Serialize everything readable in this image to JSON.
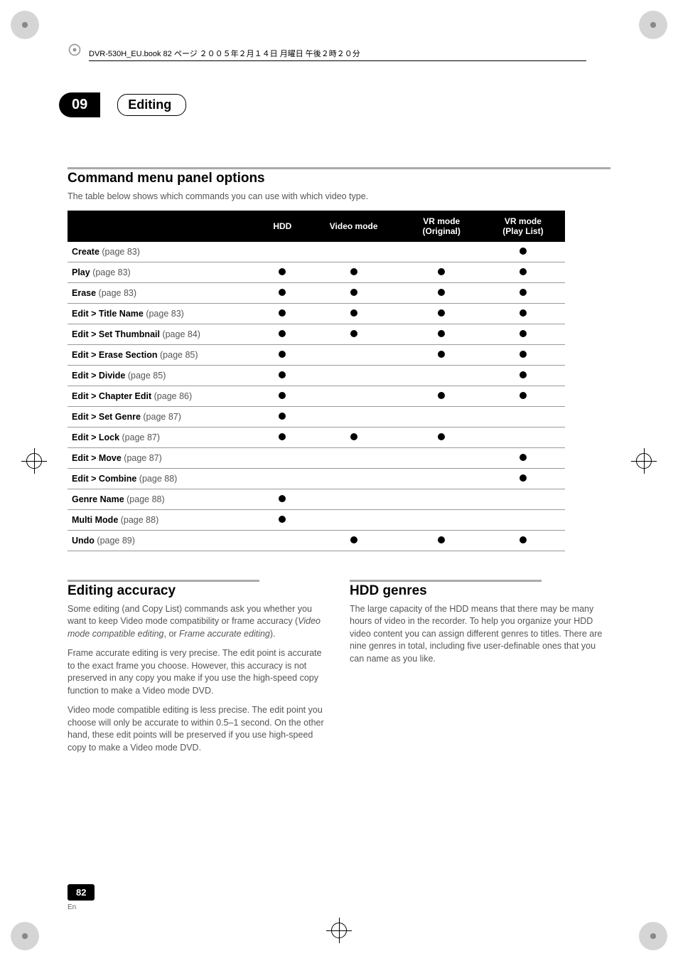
{
  "header": {
    "file_info": "DVR-530H_EU.book 82 ページ ２００５年２月１４日 月曜日 午後２時２０分"
  },
  "badge": {
    "number": "09",
    "section": "Editing"
  },
  "section1": {
    "title": "Command menu panel options",
    "intro": "The table below shows which commands you can use with which video type."
  },
  "table": {
    "headers": [
      "",
      "HDD",
      "Video mode",
      "VR mode (Original)",
      "VR mode (Play List)"
    ],
    "rows": [
      {
        "label_bold": "Create",
        "label_rest": " (page 83)",
        "cells": [
          "",
          "",
          "",
          "●"
        ]
      },
      {
        "label_bold": "Play",
        "label_rest": " (page 83)",
        "cells": [
          "●",
          "●",
          "●",
          "●"
        ]
      },
      {
        "label_bold": "Erase",
        "label_rest": " (page 83)",
        "cells": [
          "●",
          "●",
          "●",
          "●"
        ]
      },
      {
        "label_bold": "Edit > Title Name",
        "label_rest": " (page 83)",
        "cells": [
          "●",
          "●",
          "●",
          "●"
        ]
      },
      {
        "label_bold": "Edit > Set Thumbnail",
        "label_rest": " (page 84)",
        "cells": [
          "●",
          "●",
          "●",
          "●"
        ]
      },
      {
        "label_bold": "Edit > Erase Section",
        "label_rest": " (page 85)",
        "cells": [
          "●",
          "",
          "●",
          "●"
        ]
      },
      {
        "label_bold": "Edit > Divide",
        "label_rest": " (page 85)",
        "cells": [
          "●",
          "",
          "",
          "●"
        ]
      },
      {
        "label_bold": "Edit > Chapter Edit",
        "label_rest": " (page 86)",
        "cells": [
          "●",
          "",
          "●",
          "●"
        ]
      },
      {
        "label_bold": "Edit > Set Genre",
        "label_rest": " (page 87)",
        "cells": [
          "●",
          "",
          "",
          ""
        ]
      },
      {
        "label_bold": "Edit > Lock",
        "label_rest": " (page 87)",
        "cells": [
          "●",
          "●",
          "●",
          ""
        ]
      },
      {
        "label_bold": "Edit > Move",
        "label_rest": " (page 87)",
        "cells": [
          "",
          "",
          "",
          "●"
        ]
      },
      {
        "label_bold": "Edit > Combine",
        "label_rest": " (page 88)",
        "cells": [
          "",
          "",
          "",
          "●"
        ]
      },
      {
        "label_bold": "Genre Name",
        "label_rest": " (page 88)",
        "cells": [
          "●",
          "",
          "",
          ""
        ]
      },
      {
        "label_bold": "Multi Mode",
        "label_rest": " (page 88)",
        "cells": [
          "●",
          "",
          "",
          ""
        ]
      },
      {
        "label_bold": "Undo",
        "label_rest": " (page 89)",
        "cells": [
          "",
          "●",
          "●",
          "●"
        ]
      }
    ]
  },
  "section2": {
    "title": "Editing accuracy",
    "p1_pre": "Some editing (and Copy List) commands ask you whether you want to keep Video mode compatibility or frame accuracy (",
    "p1_em1": "Video mode compatible editing",
    "p1_mid": ", or ",
    "p1_em2": "Frame accurate editing",
    "p1_post": ").",
    "p2": "Frame accurate editing is very precise. The edit point is accurate to the exact frame you choose. However, this accuracy is not preserved in any copy you make if you use the high-speed copy function to make a Video mode DVD.",
    "p3": "Video mode compatible editing is less precise. The edit point you choose will only be accurate to within 0.5–1 second. On the other hand, these edit points will be preserved if you use high-speed copy to make a Video mode DVD."
  },
  "section3": {
    "title": "HDD genres",
    "p1": "The large capacity of the HDD means that there may be many hours of video in the recorder. To help you organize your HDD video content you can assign different genres to titles. There are nine genres in total, including five user-definable ones that you can name as you like."
  },
  "footer": {
    "page": "82",
    "lang": "En"
  }
}
